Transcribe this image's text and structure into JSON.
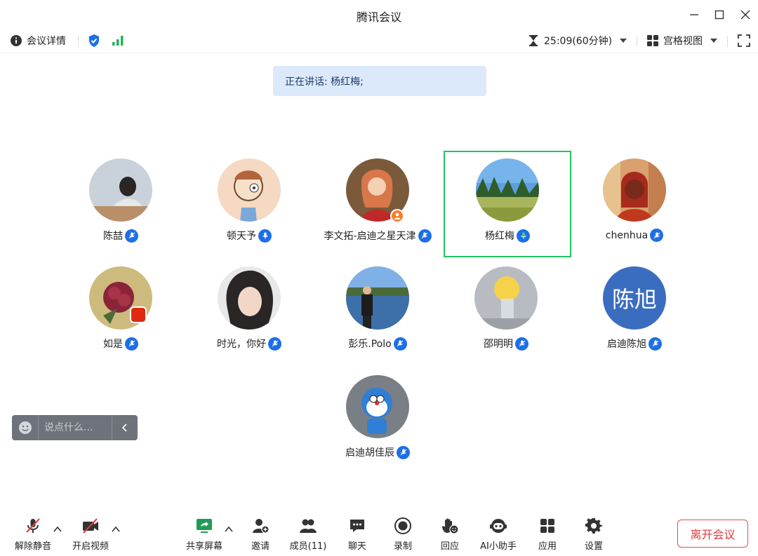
{
  "window": {
    "title": "腾讯会议"
  },
  "topbar": {
    "meeting_info": "会议详情",
    "timer": "25:09(60分钟)",
    "view_mode": "宫格视图"
  },
  "speaking": {
    "text": "正在讲话: 杨红梅;"
  },
  "participants": [
    {
      "name": "陈喆"
    },
    {
      "name": "顿天予"
    },
    {
      "name": "李文拓-启迪之星天津"
    },
    {
      "name": "杨红梅"
    },
    {
      "name": "chenhua"
    },
    {
      "name": "如是"
    },
    {
      "name": "时光，你好"
    },
    {
      "name": "彭乐.Polo"
    },
    {
      "name": "邵明明"
    },
    {
      "name": "启迪陈旭",
      "avatar_text": "陈旭"
    },
    {
      "name": "启迪胡佳辰"
    }
  ],
  "chat": {
    "placeholder": "说点什么..."
  },
  "bottombar": {
    "unmute": "解除静音",
    "start_video": "开启视频",
    "share_screen": "共享屏幕",
    "invite": "邀请",
    "members": "成员(11)",
    "chat": "聊天",
    "record": "录制",
    "react": "回应",
    "ai_assistant": "AI小助手",
    "apps": "应用",
    "settings": "设置",
    "leave": "离开会议"
  },
  "colors": {
    "accent": "#1d6fe8",
    "active_border": "#22c55e",
    "leave": "#e03a3a",
    "share_green": "#1f9d55"
  }
}
